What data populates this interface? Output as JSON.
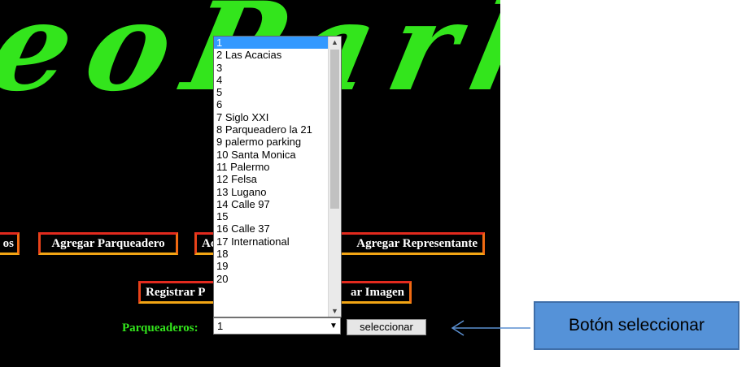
{
  "logo": {
    "text": "eoParkir",
    "color": "#33e51c"
  },
  "nav": {
    "b1": "os",
    "b2": "Agregar Parqueadero",
    "b3": "Ac",
    "b4": "Agregar Representante",
    "b5": "Registrar P",
    "b6": "ar Imagen"
  },
  "form": {
    "label": "Parqueaderos:",
    "selected": "1",
    "button": "seleccionar",
    "options": [
      "1",
      "2 Las Acacias",
      "3",
      "4",
      "5",
      "6",
      "7 Siglo XXI",
      "8 Parqueadero la 21",
      "9 palermo parking",
      "10 Santa Monica",
      "11 Palermo",
      "12 Felsa",
      "13 Lugano",
      "14 Calle 97",
      "15",
      "16 Calle 37",
      "17 International",
      "18",
      "19",
      "20"
    ]
  },
  "callout": {
    "text": "Botón seleccionar"
  },
  "icons": {
    "select_arrow": "chevron-down-icon",
    "scroll_up": "scroll-up-arrow-icon",
    "scroll_down": "scroll-down-arrow-icon",
    "pointer": "left-arrow-icon"
  },
  "colors": {
    "background": "#000000",
    "accent_green": "#33e51c",
    "button_border": "#e8421a",
    "callout_fill": "#5592d8",
    "selection": "#3399ff"
  }
}
